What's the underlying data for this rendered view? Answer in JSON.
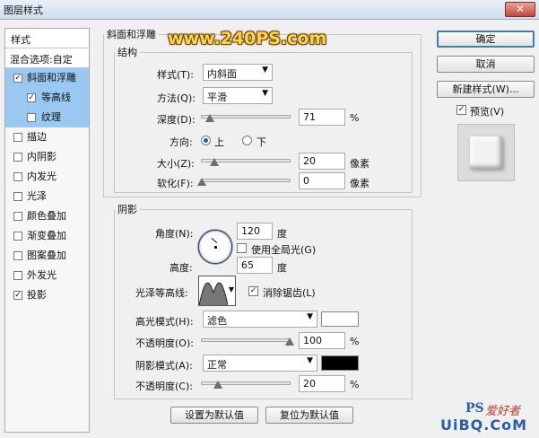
{
  "window": {
    "title": "图层样式",
    "close_glyph": "✕"
  },
  "watermark": "www.240PS.com",
  "styles": {
    "header": "样式",
    "blend_options": "混合选项:自定",
    "items": [
      {
        "label": "斜面和浮雕",
        "checked": true,
        "selected": true,
        "sub": false
      },
      {
        "label": "等高线",
        "checked": true,
        "selected": true,
        "sub": true
      },
      {
        "label": "纹理",
        "checked": false,
        "selected": true,
        "sub": true
      },
      {
        "label": "描边",
        "checked": false,
        "selected": false,
        "sub": false
      },
      {
        "label": "内阴影",
        "checked": false,
        "selected": false,
        "sub": false
      },
      {
        "label": "内发光",
        "checked": false,
        "selected": false,
        "sub": false
      },
      {
        "label": "光泽",
        "checked": false,
        "selected": false,
        "sub": false
      },
      {
        "label": "颜色叠加",
        "checked": false,
        "selected": false,
        "sub": false
      },
      {
        "label": "渐变叠加",
        "checked": false,
        "selected": false,
        "sub": false
      },
      {
        "label": "图案叠加",
        "checked": false,
        "selected": false,
        "sub": false
      },
      {
        "label": "外发光",
        "checked": false,
        "selected": false,
        "sub": false
      },
      {
        "label": "投影",
        "checked": true,
        "selected": false,
        "sub": false
      }
    ]
  },
  "bevel": {
    "group_title": "斜面和浮雕",
    "structure_title": "结构",
    "style_label": "样式(T):",
    "style_value": "内斜面",
    "technique_label": "方法(Q):",
    "technique_value": "平滑",
    "depth_label": "深度(D):",
    "depth_value": "71",
    "depth_unit": "%",
    "direction_label": "方向:",
    "direction_up": "上",
    "direction_down": "下",
    "size_label": "大小(Z):",
    "size_value": "20",
    "size_unit": "像素",
    "soften_label": "软化(F):",
    "soften_value": "0",
    "soften_unit": "像素"
  },
  "shading": {
    "title": "阴影",
    "angle_label": "角度(N):",
    "angle_value": "120",
    "angle_unit": "度",
    "global_light_label": "使用全局光(G)",
    "altitude_label": "高度:",
    "altitude_value": "65",
    "altitude_unit": "度",
    "gloss_label": "光泽等高线:",
    "antialias_label": "消除锯齿(L)",
    "highlight_label": "高光模式(H):",
    "highlight_value": "滤色",
    "highlight_color": "#ffffff",
    "hl_opacity_label": "不透明度(O):",
    "hl_opacity_value": "100",
    "hl_opacity_unit": "%",
    "shadow_label": "阴影模式(A):",
    "shadow_value": "正常",
    "shadow_color": "#000000",
    "sh_opacity_label": "不透明度(C):",
    "sh_opacity_value": "20",
    "sh_opacity_unit": "%"
  },
  "buttons": {
    "make_default": "设置为默认值",
    "reset_default": "复位为默认值",
    "ok": "确定",
    "cancel": "取消",
    "new_style": "新建样式(W)...",
    "preview": "预览(V)"
  },
  "logo": {
    "ps": "PS",
    "site": "爱好者",
    "uibq": "UiBQ.CoM"
  }
}
